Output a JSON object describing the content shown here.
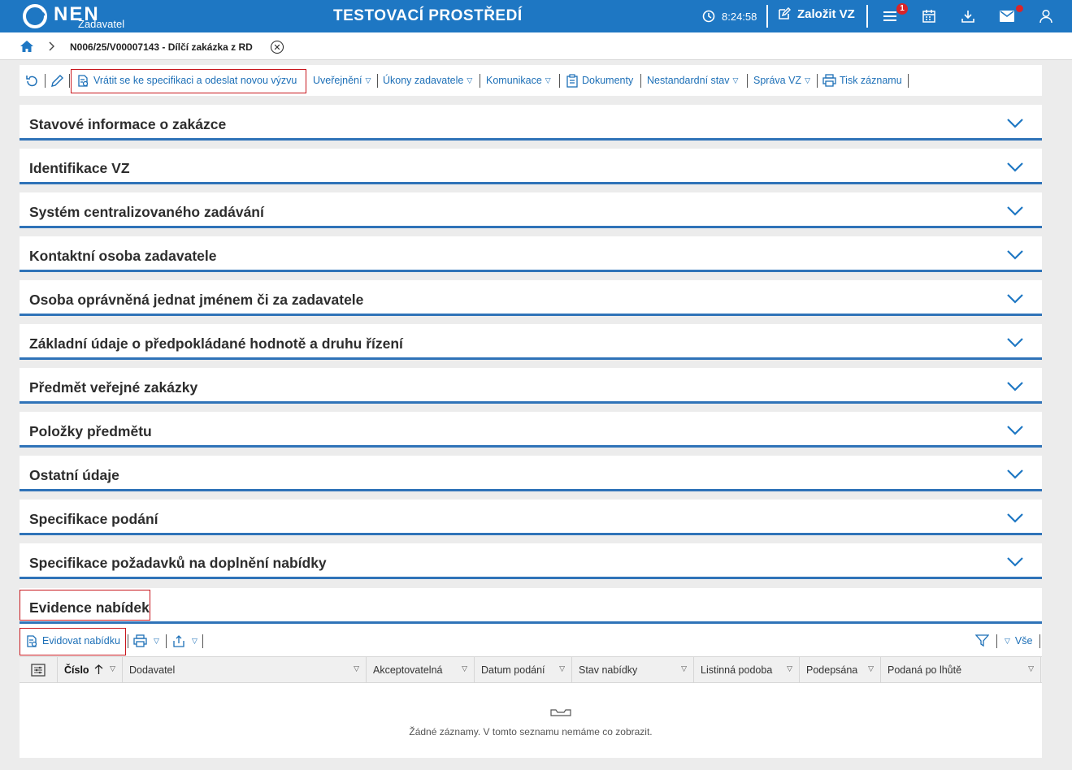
{
  "app": {
    "logo_text": "NEN",
    "logo_sub": "Zadavatel",
    "env_title": "TESTOVACÍ PROSTŘEDÍ",
    "clock": "8:24:58",
    "create_label": "Založit VZ",
    "notification_count": "1"
  },
  "breadcrumb": {
    "current": "N006/25/V00007143 - Dílčí zakázka z RD"
  },
  "toolbar": {
    "return_label": "Vrátit se ke specifikaci a odeslat novou výzvu",
    "publish_label": "Uveřejnění",
    "actions_label": "Úkony zadavatele",
    "communication_label": "Komunikace",
    "documents_label": "Dokumenty",
    "nonstandard_label": "Nestandardní stav",
    "manage_label": "Správa VZ",
    "print_label": "Tisk záznamu"
  },
  "sections": [
    "Stavové informace o zakázce",
    "Identifikace VZ",
    "Systém centralizovaného zadávání",
    "Kontaktní osoba zadavatele",
    "Osoba oprávněná jednat jménem či za zadavatele",
    "Základní údaje o předpokládané hodnotě a druhu řízení",
    "Předmět veřejné zakázky",
    "Položky předmětu",
    "Ostatní údaje",
    "Specifikace podání",
    "Specifikace požadavků na doplnění nabídky"
  ],
  "evidence": {
    "title": "Evidence nabídek",
    "register_label": "Evidovat nabídku",
    "filter_all_label": "Vše",
    "columns": [
      "Číslo",
      "Dodavatel",
      "Akceptovatelná",
      "Datum podání",
      "Stav nabídky",
      "Listinná podoba",
      "Podepsána",
      "Podaná po lhůtě"
    ],
    "empty_text": "Žádné záznamy. V tomto seznamu nemáme co zobrazit."
  },
  "colors": {
    "brand_blue": "#1e77c3",
    "link_blue": "#1c6fb7",
    "highlight_red": "#c8161d",
    "badge_red": "#d9252a"
  }
}
